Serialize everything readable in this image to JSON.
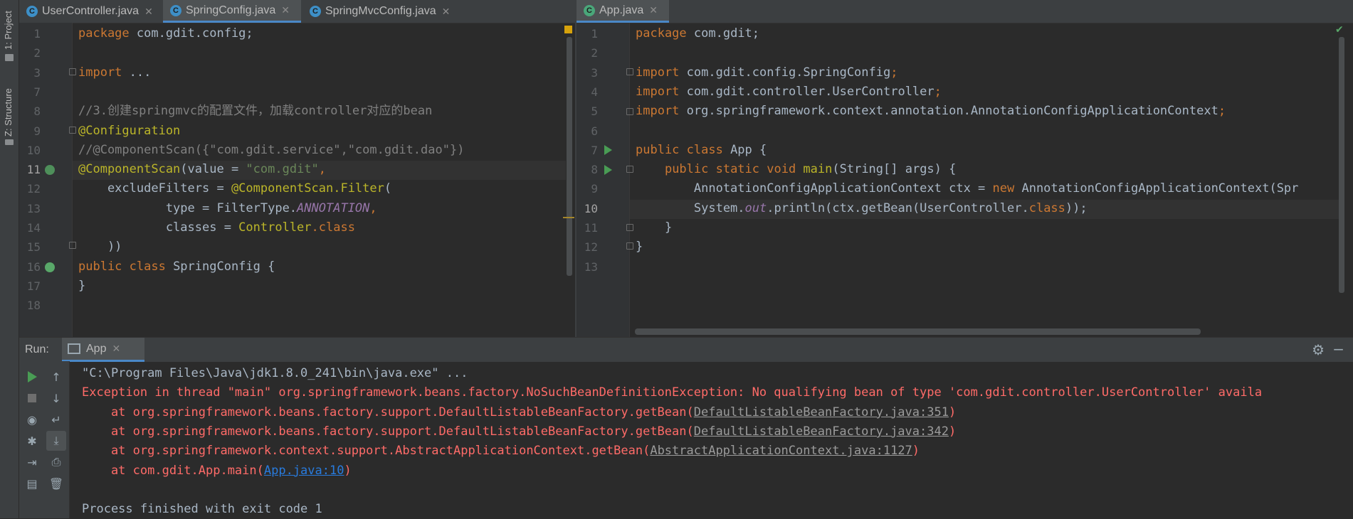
{
  "tool_strip": {
    "project_label": "1: Project",
    "structure_label": "Z: Structure"
  },
  "left_editor": {
    "tabs": [
      {
        "label": "UserController.java",
        "icon": "C",
        "active": false
      },
      {
        "label": "SpringConfig.java",
        "icon": "C",
        "active": true
      },
      {
        "label": "SpringMvcConfig.java",
        "icon": "C",
        "active": false
      }
    ],
    "line_numbers": [
      "1",
      "2",
      "3",
      "7",
      "8",
      "9",
      "10",
      "11",
      "12",
      "13",
      "14",
      "15",
      "16",
      "17",
      "18"
    ],
    "current_line": "11",
    "lines": [
      [
        [
          "kw",
          "package "
        ],
        [
          "",
          "com.gdit.config;"
        ]
      ],
      [],
      [
        [
          "kw",
          "import "
        ],
        [
          "",
          "..."
        ]
      ],
      [],
      [
        [
          "cmt",
          "//3.创建springmvc的配置文件，加载controller对应的bean"
        ]
      ],
      [
        [
          "ann",
          "@Configuration"
        ]
      ],
      [
        [
          "cmt",
          "//@ComponentScan({\"com.gdit.service\",\"com.gdit.dao\"})"
        ]
      ],
      [
        [
          "ann",
          "@ComponentScan"
        ],
        [
          "",
          "(value = "
        ],
        [
          "str",
          "\"com.gdit\""
        ],
        [
          "kw",
          ","
        ]
      ],
      [
        [
          "",
          "    excludeFilters = "
        ],
        [
          "ann",
          "@ComponentScan.Filter"
        ],
        [
          "",
          "("
        ]
      ],
      [
        [
          "",
          "            type = FilterType."
        ],
        [
          "it",
          "ANNOTATION"
        ],
        [
          "kw",
          ","
        ]
      ],
      [
        [
          "",
          "            classes = "
        ],
        [
          "ann",
          "Controller"
        ],
        [
          "kw",
          ".class"
        ]
      ],
      [
        [
          "",
          "    ))"
        ]
      ],
      [
        [
          "kw",
          "public class "
        ],
        [
          "",
          "SpringConfig {"
        ]
      ],
      [
        [
          "",
          "}"
        ]
      ],
      []
    ]
  },
  "right_editor": {
    "tabs": [
      {
        "label": "App.java",
        "icon": "C",
        "active": true
      }
    ],
    "line_numbers": [
      "1",
      "2",
      "3",
      "4",
      "5",
      "6",
      "7",
      "8",
      "9",
      "10",
      "11",
      "12",
      "13"
    ],
    "current_line": "10",
    "lines": [
      [
        [
          "kw",
          "package "
        ],
        [
          "",
          "com.gdit;"
        ]
      ],
      [],
      [
        [
          "kw",
          "import "
        ],
        [
          "",
          "com.gdit.config.SpringConfig"
        ],
        [
          "kw",
          ";"
        ]
      ],
      [
        [
          "kw",
          "import "
        ],
        [
          "",
          "com.gdit.controller.UserController"
        ],
        [
          "kw",
          ";"
        ]
      ],
      [
        [
          "kw",
          "import "
        ],
        [
          "",
          "org.springframework.context.annotation.AnnotationConfigApplicationContext"
        ],
        [
          "kw",
          ";"
        ]
      ],
      [],
      [
        [
          "kw",
          "public class "
        ],
        [
          "",
          "App {"
        ]
      ],
      [
        [
          "",
          "    "
        ],
        [
          "kw",
          "public static void "
        ],
        [
          "ann",
          "main"
        ],
        [
          "",
          "(String[] args) {"
        ]
      ],
      [
        [
          "",
          "        AnnotationConfigApplicationContext ctx = "
        ],
        [
          "kw",
          "new "
        ],
        [
          "",
          "AnnotationConfigApplicationContext(Spr"
        ]
      ],
      [
        [
          "",
          "        System."
        ],
        [
          "it",
          "out"
        ],
        [
          "",
          ".println(ctx.getBean(UserController."
        ],
        [
          "kw",
          "class"
        ],
        [
          "",
          "));"
        ]
      ],
      [
        [
          "",
          "    }"
        ]
      ],
      [
        [
          "",
          "}"
        ]
      ],
      []
    ]
  },
  "run_panel": {
    "label": "Run:",
    "tab_label": "App",
    "console": [
      [
        [
          "",
          "\"C:\\Program Files\\Java\\jdk1.8.0_241\\bin\\java.exe\" ..."
        ]
      ],
      [
        [
          "err",
          "Exception in thread \"main\" org.springframework.beans.factory.NoSuchBeanDefinitionException: No qualifying bean of type 'com.gdit.controller.UserController' availa"
        ]
      ],
      [
        [
          "err",
          "    at org.springframework.beans.factory.support.DefaultListableBeanFactory.getBean("
        ],
        [
          "ulink",
          "DefaultListableBeanFactory.java:351"
        ],
        [
          "err",
          ")"
        ]
      ],
      [
        [
          "err",
          "    at org.springframework.beans.factory.support.DefaultListableBeanFactory.getBean("
        ],
        [
          "ulink",
          "DefaultListableBeanFactory.java:342"
        ],
        [
          "err",
          ")"
        ]
      ],
      [
        [
          "err",
          "    at org.springframework.context.support.AbstractApplicationContext.getBean("
        ],
        [
          "ulink",
          "AbstractApplicationContext.java:1127"
        ],
        [
          "err",
          ")"
        ]
      ],
      [
        [
          "err",
          "    at com.gdit.App.main("
        ],
        [
          "link",
          "App.java:10"
        ],
        [
          "err",
          ")"
        ]
      ],
      [],
      [
        [
          "",
          "Process finished with exit code 1"
        ]
      ]
    ]
  },
  "colors": {
    "background": "#2b2b2b",
    "keyword": "#cc7832",
    "string": "#6a8759",
    "annotation": "#bbb529",
    "error": "#ff6b68",
    "link": "#287bde"
  }
}
